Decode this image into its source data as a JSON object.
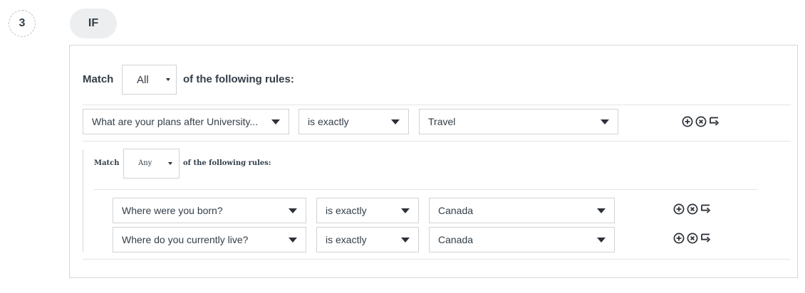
{
  "step": {
    "number": "3",
    "badge": "IF"
  },
  "outer": {
    "match_label": "Match",
    "match_value": "All",
    "following_label": "of the following rules:",
    "rules": [
      {
        "field": "What are your plans after University...",
        "operator": "is exactly",
        "value": "Travel"
      }
    ]
  },
  "group": {
    "match_label": "Match",
    "match_value": "Any",
    "following_label": "of the following rules:",
    "rules": [
      {
        "field": "Where were you born?",
        "operator": "is exactly",
        "value": "Canada"
      },
      {
        "field": "Where do you currently live?",
        "operator": "is exactly",
        "value": "Canada"
      }
    ]
  },
  "icons": {
    "add": "add-circle-icon",
    "remove": "remove-circle-icon",
    "group": "add-group-icon"
  },
  "colors": {
    "text": "#333e48",
    "border": "#cfd3d7",
    "badge_bg": "#eceef0"
  }
}
